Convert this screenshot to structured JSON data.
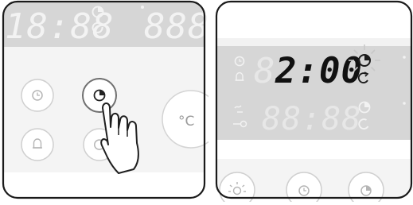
{
  "left_panel": {
    "display": {
      "clock_segments": "18:88",
      "right_segments": "888"
    },
    "controls": {
      "temperature_unit": "°C"
    }
  },
  "right_panel": {
    "display": {
      "time_value": "2:00",
      "time_leading_segment": "8",
      "lower_segments": "88:88"
    }
  },
  "icons": [
    "clock-icon",
    "timer-icon",
    "cycle-icon",
    "bell-icon",
    "hand-pointer-icon",
    "key-icon",
    "steam-icon",
    "light-icon"
  ],
  "colors": {
    "display_band": "#d6d6d6",
    "control_area": "#f4f4f4",
    "active_digits": "#111111",
    "frame": "#1a1a1a"
  }
}
